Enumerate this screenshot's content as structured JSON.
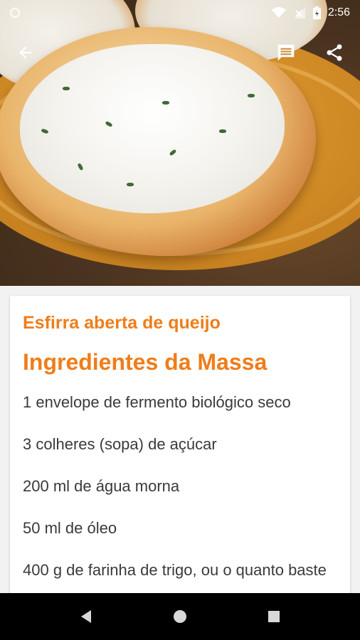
{
  "status_bar": {
    "time": "2:56",
    "icons": [
      "circle-indicator-icon",
      "wifi-icon",
      "signal-icon",
      "battery-icon"
    ]
  },
  "toolbar": {
    "back_icon": "arrow-back-icon",
    "actions": [
      "comments-icon",
      "share-icon"
    ]
  },
  "recipe": {
    "title": "Esfirra aberta de queijo",
    "section_title": "Ingredientes da Massa",
    "ingredients": [
      "1 envelope de fermento biológico seco",
      "3 colheres (sopa) de açúcar",
      "200 ml de água morna",
      "50 ml de óleo",
      "400 g de farinha de trigo, ou o quanto baste"
    ]
  },
  "colors": {
    "accent": "#ef7d1a",
    "text": "#3a3a3a",
    "nav_bar": "#000000"
  },
  "nav_bar": {
    "buttons": [
      "back-triangle-icon",
      "home-circle-icon",
      "recents-square-icon"
    ]
  }
}
